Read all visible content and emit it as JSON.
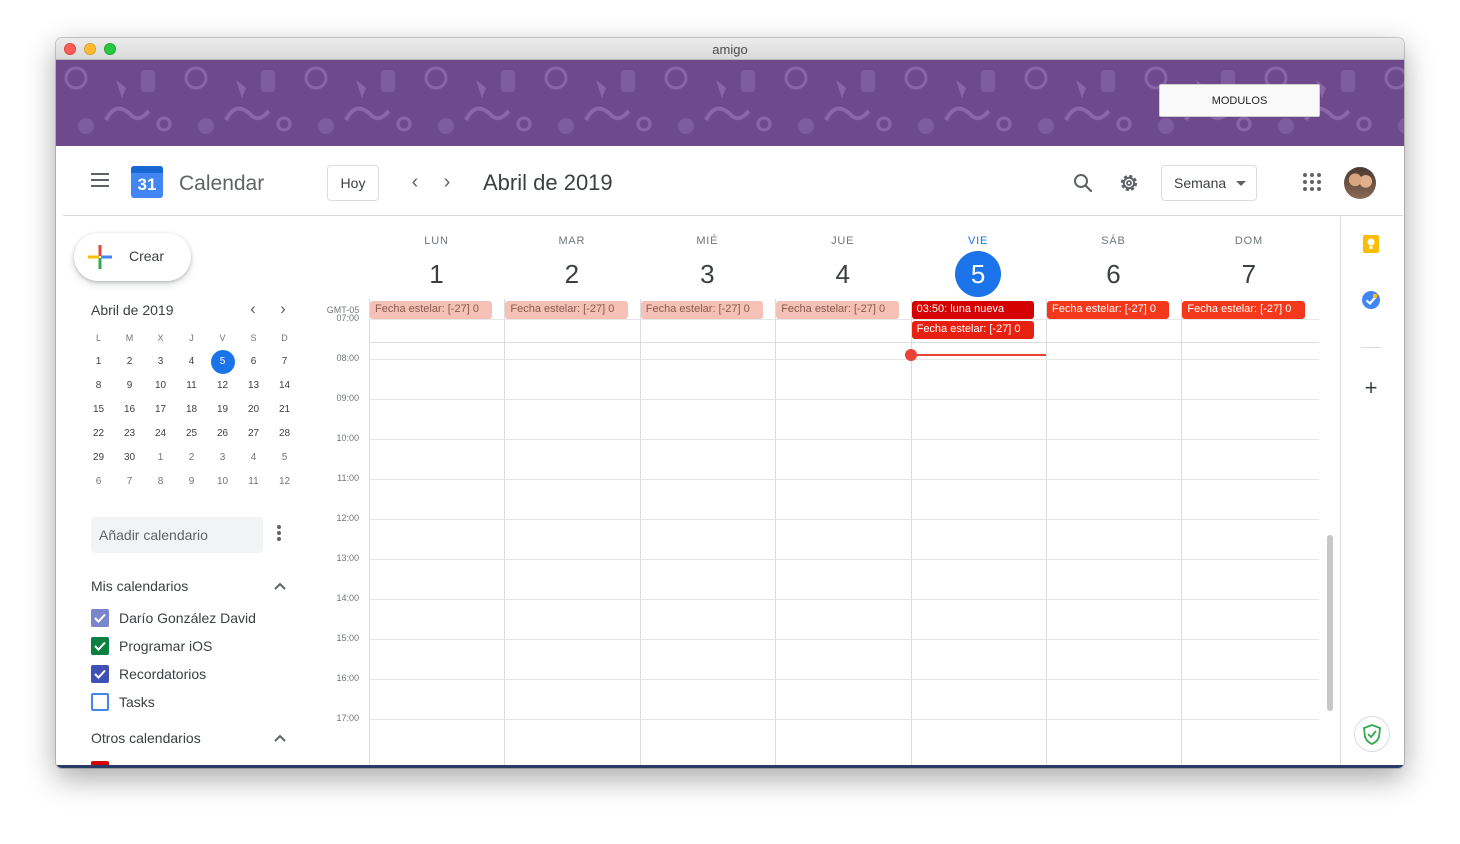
{
  "window": {
    "title": "amigo"
  },
  "banner": {
    "button_label": "MODULOS",
    "color": "#6e4a8c"
  },
  "header": {
    "app_name": "Calendar",
    "logo_number": "31",
    "today_label": "Hoy",
    "month_title": "Abril de 2019",
    "view_label": "Semana",
    "icons": [
      "menu-icon",
      "calendar-logo",
      "chevron-left-icon",
      "chevron-right-icon",
      "search-icon",
      "gear-icon",
      "apps-icon",
      "avatar"
    ]
  },
  "sidebar": {
    "create_label": "Crear",
    "mini_title": "Abril de 2019",
    "weekday_heads": [
      "L",
      "M",
      "X",
      "J",
      "V",
      "S",
      "D"
    ],
    "weeks": [
      [
        "1",
        "2",
        "3",
        "4",
        "5",
        "6",
        "7"
      ],
      [
        "8",
        "9",
        "10",
        "11",
        "12",
        "13",
        "14"
      ],
      [
        "15",
        "16",
        "17",
        "18",
        "19",
        "20",
        "21"
      ],
      [
        "22",
        "23",
        "24",
        "25",
        "26",
        "27",
        "28"
      ],
      [
        "29",
        "30",
        "1",
        "2",
        "3",
        "4",
        "5"
      ],
      [
        "6",
        "7",
        "8",
        "9",
        "10",
        "11",
        "12"
      ]
    ],
    "selected_day": "5",
    "add_calendar_placeholder": "Añadir calendario",
    "my_calendars_title": "Mis calendarios",
    "my_calendars": [
      {
        "label": "Darío González David",
        "color": "#7986cb",
        "checked": true
      },
      {
        "label": "Programar iOS",
        "color": "#0b8043",
        "checked": true
      },
      {
        "label": "Recordatorios",
        "color": "#3f51b5",
        "checked": true
      },
      {
        "label": "Tasks",
        "color": "#4285f4",
        "checked": false
      }
    ],
    "other_calendars_title": "Otros calendarios"
  },
  "week": {
    "timezone": "GMT-05",
    "days": [
      {
        "name": "LUN",
        "num": "1",
        "today": false
      },
      {
        "name": "MAR",
        "num": "2",
        "today": false
      },
      {
        "name": "MIÉ",
        "num": "3",
        "today": false
      },
      {
        "name": "JUE",
        "num": "4",
        "today": false
      },
      {
        "name": "VIE",
        "num": "5",
        "today": true
      },
      {
        "name": "SÁB",
        "num": "6",
        "today": false
      },
      {
        "name": "DOM",
        "num": "7",
        "today": false
      }
    ],
    "allday_events": [
      {
        "day": 0,
        "label": "Fecha estelar: [-27] 0",
        "state": "past"
      },
      {
        "day": 1,
        "label": "Fecha estelar: [-27] 0",
        "state": "past"
      },
      {
        "day": 2,
        "label": "Fecha estelar: [-27] 0",
        "state": "past"
      },
      {
        "day": 3,
        "label": "Fecha estelar: [-27] 0",
        "state": "past"
      },
      {
        "day": 4,
        "label": "03:50: luna nueva",
        "state": "moon",
        "row": 0
      },
      {
        "day": 4,
        "label": "Fecha estelar: [-27] 0",
        "state": "today",
        "row": 1
      },
      {
        "day": 5,
        "label": "Fecha estelar: [-27] 0",
        "state": "future"
      },
      {
        "day": 6,
        "label": "Fecha estelar: [-27] 0",
        "state": "future"
      }
    ],
    "hours": [
      "07:00",
      "08:00",
      "09:00",
      "10:00",
      "11:00",
      "12:00",
      "13:00",
      "14:00",
      "15:00",
      "16:00",
      "17:00"
    ],
    "current_time_hour": 7.9,
    "now_color": "#ea4335",
    "accent": "#1a73e8"
  },
  "side_panel": {
    "icons": [
      "keep-icon",
      "tasks-icon",
      "add-icon",
      "shield-icon"
    ]
  }
}
